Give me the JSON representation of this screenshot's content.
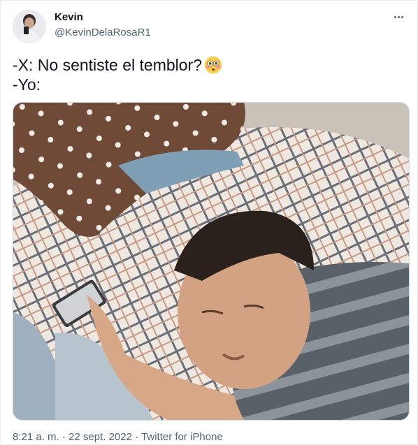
{
  "author": {
    "display_name": "Kevin",
    "handle": "@KevinDelaRosaR1"
  },
  "tweet": {
    "line1": "-X: No sentiste el temblor?",
    "emoji": "flushed-face-emoji",
    "line2": "-Yo:"
  },
  "media": {
    "description_icon": "photo"
  },
  "meta": {
    "time": "8:21 a. m.",
    "separator": " · ",
    "date": "22 sept. 2022",
    "source": "Twitter for iPhone"
  },
  "colors": {
    "text": "#0f1419",
    "secondary": "#536471",
    "border": "#e6ecf0"
  }
}
